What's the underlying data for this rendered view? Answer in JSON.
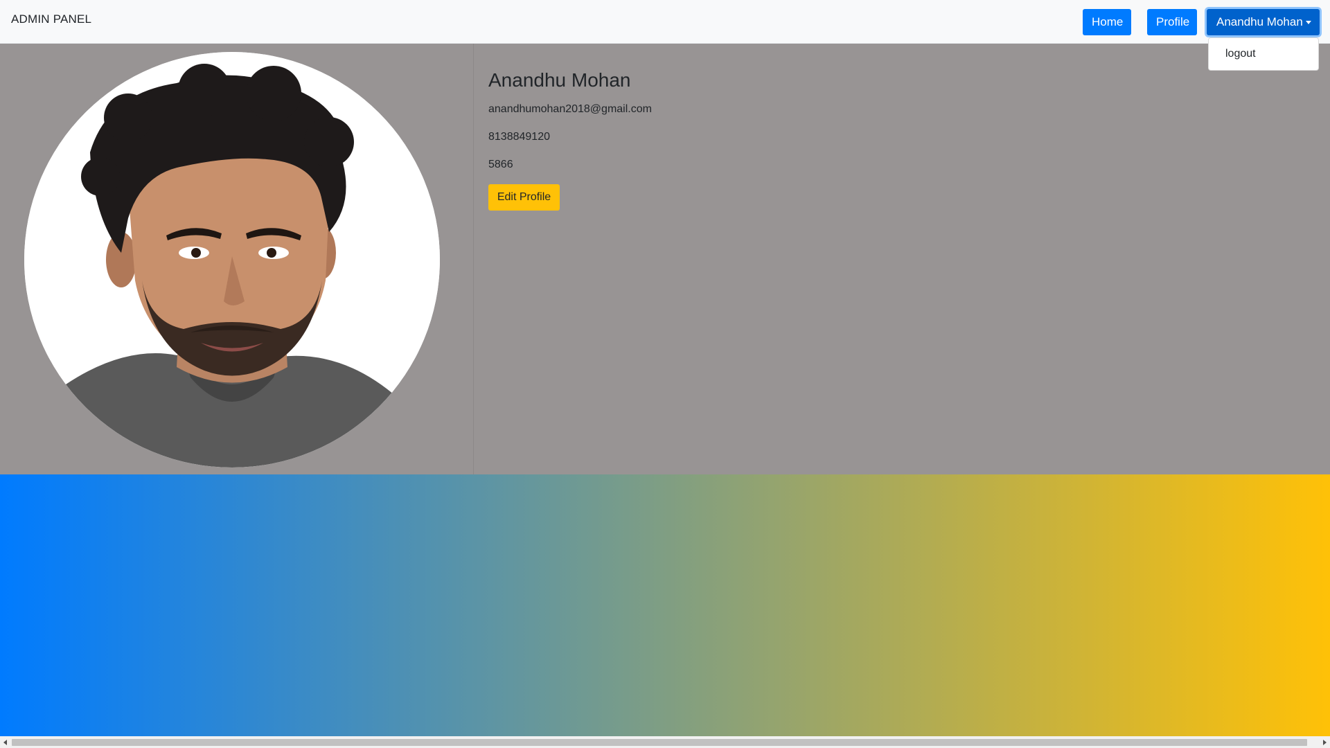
{
  "navbar": {
    "brand": "ADMIN PANEL",
    "home_label": "Home",
    "profile_label": "Profile",
    "user_menu_label": "Anandhu Mohan",
    "dropdown_items": [
      "logout"
    ]
  },
  "profile": {
    "name": "Anandhu Mohan",
    "email": "anandhumohan2018@gmail.com",
    "phone": "8138849120",
    "code": "5866",
    "edit_button_label": "Edit Profile"
  },
  "colors": {
    "primary": "#007bff",
    "warning": "#ffc107",
    "panel_bg": "#989494",
    "navbar_bg": "#f8f9fa"
  }
}
